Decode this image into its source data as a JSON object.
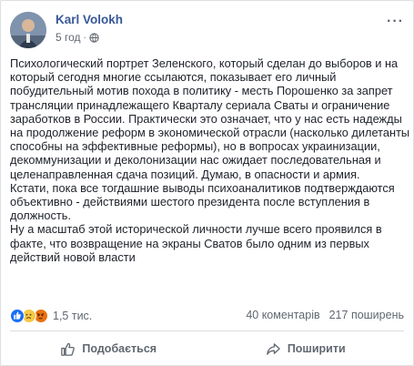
{
  "post": {
    "author": "Karl Volokh",
    "time": "5 год",
    "separator": "·",
    "more_label": "···",
    "paragraphs": [
      "Психологический портрет Зеленского, который сделан до выборов и на который сегодня многие ссылаются, показывает его личный побудительный мотив похода в политику - месть Порошенко за запрет трансляции принадлежащего Кварталу сериала Сваты и ограничение заработков в России. Практически это означает, что у нас есть надежды на продолжение реформ в экономической отрасли (насколько дилетанты способны на эффективные реформы), но в вопросах украинизации, декоммунизации и деколонизации нас ожидает последовательная и целенаправленная сдача позиций. Думаю, в опасности и армия.",
      "Кстати, пока все тогдашние выводы психоаналитиков подтверждаются объективно - действиями шестого президента после вступления в должность.",
      "Ну а масштаб этой исторической личности лучше всего проявился в факте, что возвращение на экраны Сватов было одним из первых действий новой власти"
    ]
  },
  "stats": {
    "reactions_count": "1,5 тис.",
    "comments": "40 коментарів",
    "shares": "217 поширень"
  },
  "actions": {
    "like": "Подобається",
    "share": "Поширити"
  },
  "colors": {
    "author_link": "#385898",
    "like_blue": "#1a6ef5",
    "sad_yellow": "#f7c947",
    "angry_orange": "#e9710f"
  }
}
